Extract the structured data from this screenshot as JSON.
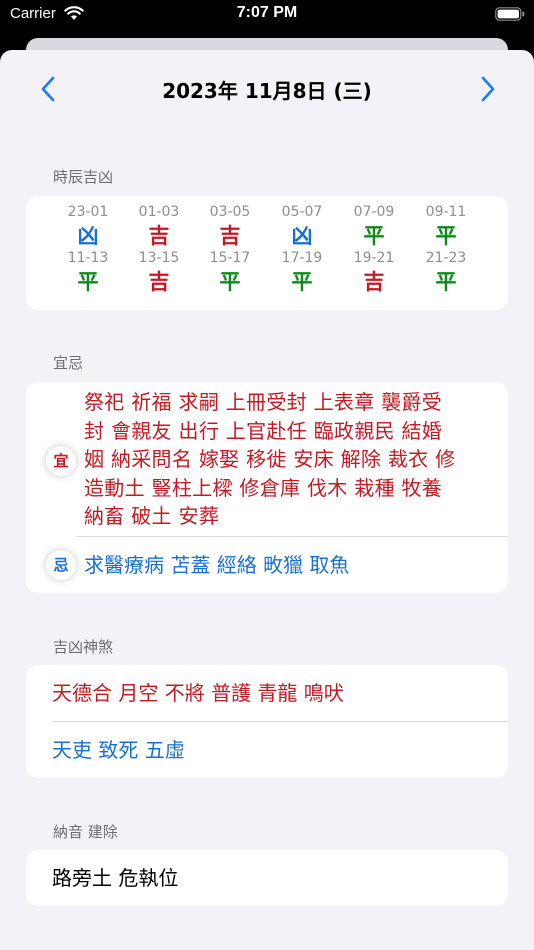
{
  "status_bar": {
    "carrier": "Carrier",
    "time": "7:07 PM"
  },
  "header": {
    "date_title": "2023年 11月8日 (三)"
  },
  "hours": {
    "title": "時辰吉凶",
    "cells": [
      {
        "range": "23-01",
        "luck": "凶",
        "color": "#1a6fd4"
      },
      {
        "range": "01-03",
        "luck": "吉",
        "color": "#c41a23"
      },
      {
        "range": "03-05",
        "luck": "吉",
        "color": "#c41a23"
      },
      {
        "range": "05-07",
        "luck": "凶",
        "color": "#1a6fd4"
      },
      {
        "range": "07-09",
        "luck": "平",
        "color": "#0e8a1c"
      },
      {
        "range": "09-11",
        "luck": "平",
        "color": "#0e8a1c"
      },
      {
        "range": "11-13",
        "luck": "平",
        "color": "#0e8a1c"
      },
      {
        "range": "13-15",
        "luck": "吉",
        "color": "#c41a23"
      },
      {
        "range": "15-17",
        "luck": "平",
        "color": "#0e8a1c"
      },
      {
        "range": "17-19",
        "luck": "平",
        "color": "#0e8a1c"
      },
      {
        "range": "19-21",
        "luck": "吉",
        "color": "#c41a23"
      },
      {
        "range": "21-23",
        "luck": "平",
        "color": "#0e8a1c"
      }
    ]
  },
  "yiji": {
    "title": "宜忌",
    "yi_label": "宜",
    "yi_lines": [
      "祭祀 祈福 求嗣 上冊受封 上表章 襲爵受",
      "封 會親友 出行 上官赴任 臨政親民 結婚",
      "姻 納采問名 嫁娶 移徙 安床 解除 裁衣 修",
      "造動土 豎柱上樑 修倉庫 伐木 栽種 牧養",
      "納畜 破土 安葬"
    ],
    "ji_label": "忌",
    "ji_text": "求醫療病 苫蓋 經絡 畋獵 取魚"
  },
  "shensha": {
    "title": "吉凶神煞",
    "good": "天德合 月空 不將 普護 青龍 鳴吠",
    "bad": "天吏 致死 五虛"
  },
  "nayin": {
    "title": "納音 建除",
    "value": "路旁土  危執位"
  },
  "colors": {
    "good": "#c41a23",
    "bad": "#1a6fd4",
    "neutral": "#0e8a1c",
    "accent": "#1a7cf5"
  }
}
